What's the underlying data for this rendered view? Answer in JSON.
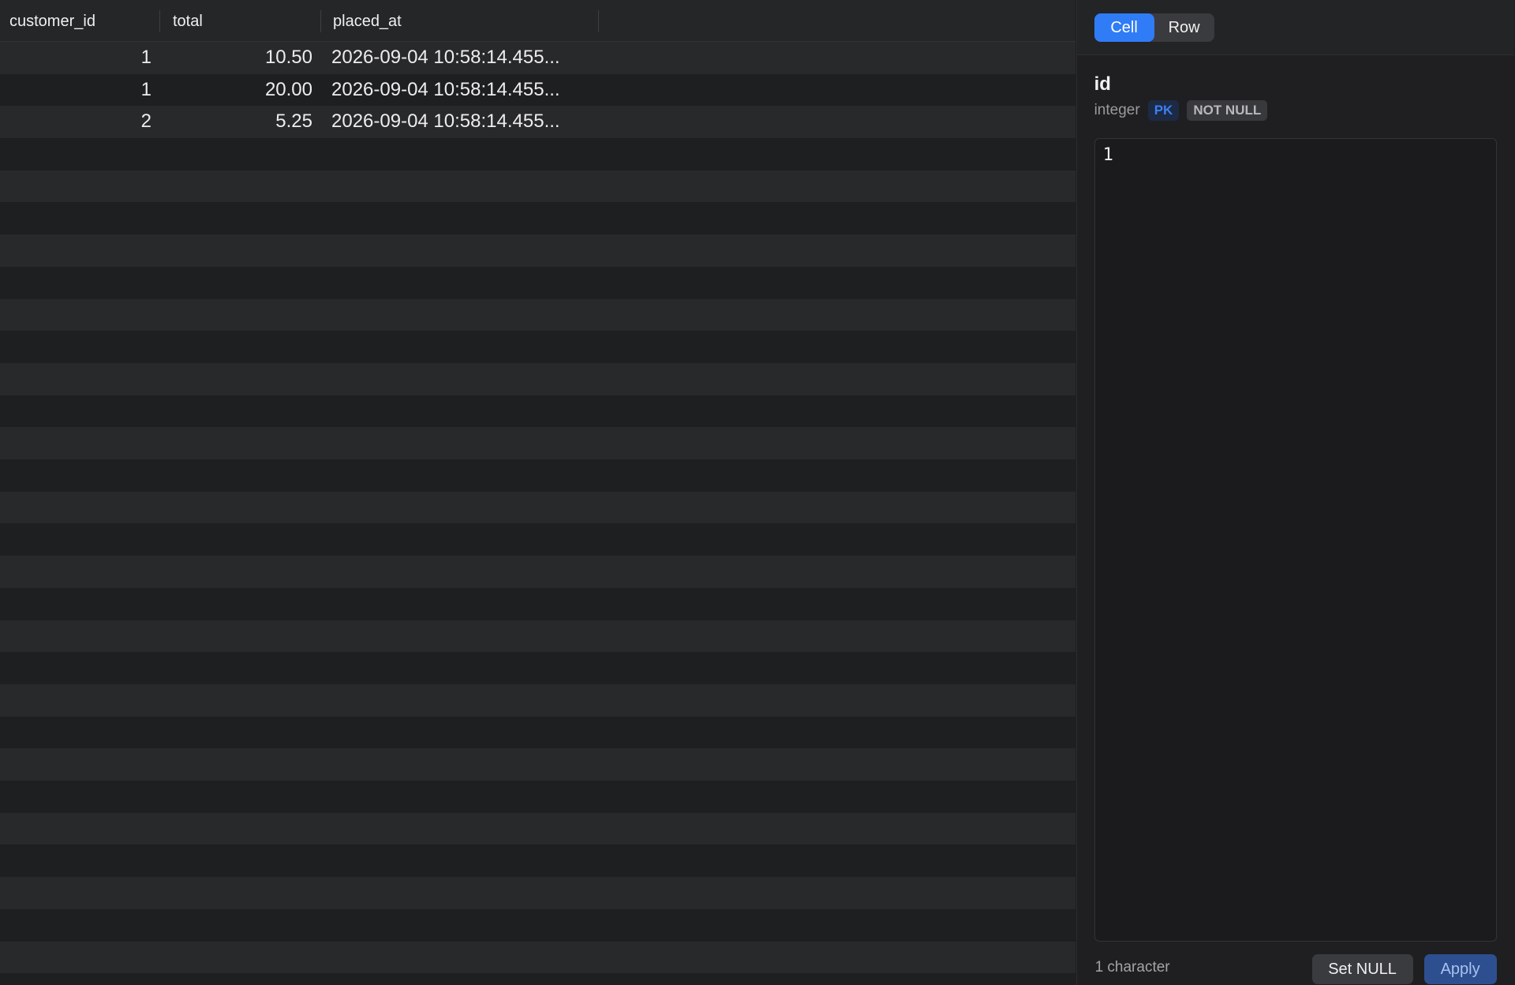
{
  "grid": {
    "columns": [
      {
        "label": "customer_id"
      },
      {
        "label": "total"
      },
      {
        "label": "placed_at"
      }
    ],
    "rows": [
      {
        "customer_id": "1",
        "total": "10.50",
        "placed_at": "2026-09-04 10:58:14.455..."
      },
      {
        "customer_id": "1",
        "total": "20.00",
        "placed_at": "2026-09-04 10:58:14.455..."
      },
      {
        "customer_id": "2",
        "total": "5.25",
        "placed_at": "2026-09-04 10:58:14.455..."
      }
    ]
  },
  "inspector": {
    "tabs": [
      {
        "label": "Cell",
        "active": true
      },
      {
        "label": "Row",
        "active": false
      }
    ],
    "field_name": "id",
    "field_type": "integer",
    "badges": {
      "pk": "PK",
      "not_null": "NOT NULL"
    },
    "value": "1",
    "char_count": "1 character",
    "set_null_label": "Set NULL",
    "apply_label": "Apply"
  },
  "colors": {
    "accent": "#2f7cf6",
    "pk_badge_text": "#3c7ff0",
    "apply_bg": "#2d4f8f"
  }
}
